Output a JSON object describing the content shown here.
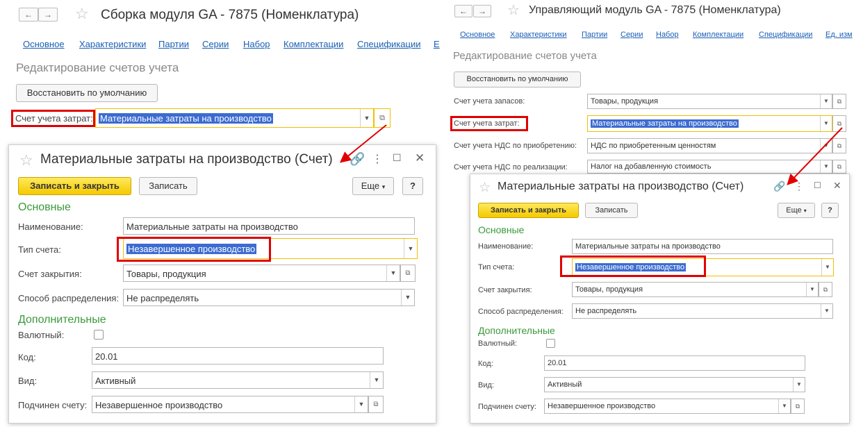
{
  "left": {
    "nav": {
      "back": "←",
      "forward": "→"
    },
    "window_title": "Сборка модуля GA - 7875 (Номенклатура)",
    "tabs": [
      "Основное",
      "Характеристики",
      "Партии",
      "Серии",
      "Набор",
      "Комплектации",
      "Спецификации",
      "E"
    ],
    "section_title": "Редактирование счетов учета",
    "restore_button": "Восстановить по умолчанию",
    "cost_account": {
      "label": "Счет учета затрат:",
      "value": "Материальные затраты на производство"
    }
  },
  "right": {
    "nav": {
      "back": "←",
      "forward": "→"
    },
    "window_title": "Управляющий модуль GA - 7875 (Номенклатура)",
    "tabs": [
      "Основное",
      "Характеристики",
      "Партии",
      "Серии",
      "Набор",
      "Комплектации",
      "Спецификации",
      "Ед. изм"
    ],
    "section_title": "Редактирование счетов учета",
    "restore_button": "Восстановить по умолчанию",
    "fields": [
      {
        "label": "Счет учета запасов:",
        "value": "Товары, продукция"
      },
      {
        "label": "Счет учета затрат:",
        "value": "Материальные затраты на производство"
      },
      {
        "label": "Счет учета НДС по приобретению:",
        "value": "НДС по приобретенным ценностям"
      },
      {
        "label": "Счет учета НДС по реализации:",
        "value": "Налог на добавленную стоимость"
      }
    ]
  },
  "dialog": {
    "title": "Материальные затраты на производство (Счет)",
    "save_close": "Записать и закрыть",
    "save": "Записать",
    "more": "Еще",
    "help": "?",
    "group_main": "Основные",
    "name": {
      "label": "Наименование:",
      "value": "Материальные затраты на производство"
    },
    "type": {
      "label": "Тип счета:",
      "value": "Незавершенное производство"
    },
    "closing": {
      "label": "Счет закрытия:",
      "value": "Товары, продукция"
    },
    "distribution": {
      "label": "Способ распределения:",
      "value": "Не распределять"
    },
    "group_extra": "Дополнительные",
    "currency": {
      "label": "Валютный:",
      "checked": false
    },
    "code": {
      "label": "Код:",
      "value": "20.01"
    },
    "kind": {
      "label": "Вид:",
      "value": "Активный"
    },
    "parent": {
      "label": "Подчинен счету:",
      "value": "Незавершенное производство"
    }
  },
  "icons": {
    "star": "star-icon",
    "link": "link-icon",
    "menu": "more-vert-icon",
    "maximize": "maximize-icon",
    "close": "close-icon",
    "dropdown": "chevron-down-icon",
    "open": "open-icon"
  },
  "colors": {
    "highlight": "#e00000",
    "focus": "#f0c000",
    "selection": "#3c6bd1",
    "group": "#3a9a3a",
    "primary_button": "#f5c900"
  }
}
